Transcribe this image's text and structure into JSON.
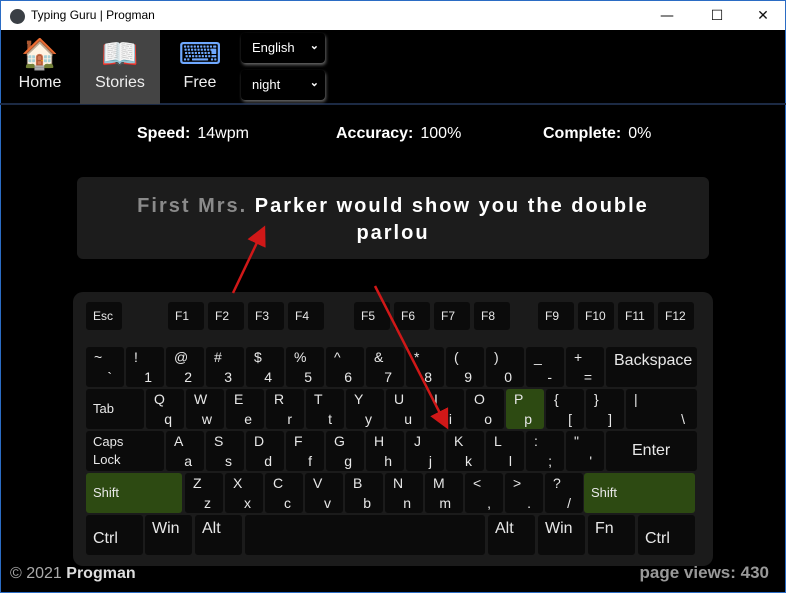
{
  "window": {
    "title": "Typing Guru | Progman",
    "minimize": "—",
    "maximize": "☐",
    "close": "✕"
  },
  "nav": {
    "tabs": [
      {
        "label": "Home",
        "icon": "🏠"
      },
      {
        "label": "Stories",
        "icon": "📖"
      },
      {
        "label": "Free",
        "icon": "⌨"
      }
    ],
    "active": "Stories",
    "language": "English",
    "theme": "night"
  },
  "stats": {
    "speed_label": "Speed:",
    "speed": "14wpm",
    "accuracy_label": "Accuracy:",
    "accuracy": "100%",
    "complete_label": "Complete:",
    "complete": "0%"
  },
  "story": {
    "typed": "First Mrs.",
    "remaining": "Parker would show you the double parlou"
  },
  "keyboard": {
    "highlight_color": "#2d4a12",
    "function_row": [
      "Esc",
      "F1",
      "F2",
      "F3",
      "F4",
      "F5",
      "F6",
      "F7",
      "F8",
      "F9",
      "F10",
      "F11",
      "F12"
    ],
    "number_row": [
      [
        "~",
        "`"
      ],
      [
        "!",
        "1"
      ],
      [
        "@",
        "2"
      ],
      [
        "#",
        "3"
      ],
      [
        "$",
        "4"
      ],
      [
        "%",
        "5"
      ],
      [
        "^",
        "6"
      ],
      [
        "&",
        "7"
      ],
      [
        "*",
        "8"
      ],
      [
        "(",
        "9"
      ],
      [
        ")",
        "0"
      ],
      [
        "_",
        "-"
      ],
      [
        "+",
        "="
      ],
      [
        "Backspace"
      ]
    ],
    "top_row": [
      [
        "Tab"
      ],
      [
        "Q",
        "q"
      ],
      [
        "W",
        "w"
      ],
      [
        "E",
        "e"
      ],
      [
        "R",
        "r"
      ],
      [
        "T",
        "t"
      ],
      [
        "Y",
        "y"
      ],
      [
        "U",
        "u"
      ],
      [
        "I",
        "i"
      ],
      [
        "O",
        "o"
      ],
      [
        "P",
        "p"
      ],
      [
        "{",
        "["
      ],
      [
        "}",
        "]"
      ],
      [
        "|",
        "\\"
      ]
    ],
    "home_row": [
      [
        "Caps\nLock"
      ],
      [
        "A",
        "a"
      ],
      [
        "S",
        "s"
      ],
      [
        "D",
        "d"
      ],
      [
        "F",
        "f"
      ],
      [
        "G",
        "g"
      ],
      [
        "H",
        "h"
      ],
      [
        "J",
        "j"
      ],
      [
        "K",
        "k"
      ],
      [
        "L",
        "l"
      ],
      [
        ":",
        ";"
      ],
      [
        "\"",
        "'"
      ],
      [
        "Enter"
      ]
    ],
    "shift_row": [
      [
        "Shift"
      ],
      [
        "Z",
        "z"
      ],
      [
        "X",
        "x"
      ],
      [
        "C",
        "c"
      ],
      [
        "V",
        "v"
      ],
      [
        "B",
        "b"
      ],
      [
        "N",
        "n"
      ],
      [
        "M",
        "m"
      ],
      [
        "<",
        ","
      ],
      [
        ">",
        "."
      ],
      [
        "?",
        "/"
      ],
      [
        "Shift"
      ]
    ],
    "bottom_row": [
      [
        "Ctrl"
      ],
      [
        "Win"
      ],
      [
        "Alt"
      ],
      [
        ""
      ],
      [
        "Alt"
      ],
      [
        "Win"
      ],
      [
        "Fn"
      ],
      [
        "Ctrl"
      ]
    ],
    "highlighted_keys": [
      "P",
      "Shift"
    ]
  },
  "footer": {
    "copyright": "© 2021",
    "author": "Progman",
    "page_views": "page views: 430"
  }
}
